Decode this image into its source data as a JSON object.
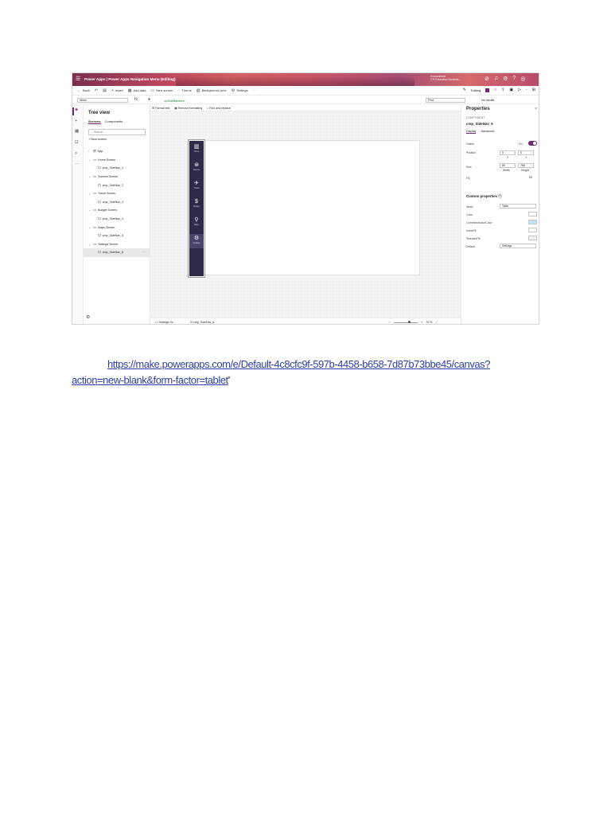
{
  "titlebar": {
    "title": "Power Apps | Power Apps Navigation Menu (Editing)",
    "environment_line1": "Environment",
    "environment_line2": "CTI Education Services..."
  },
  "commandbar": {
    "back": "Back",
    "insert": "Insert",
    "add_data": "Add data",
    "new_screen": "New screen",
    "theme": "Theme",
    "background_color": "Background color",
    "settings": "Settings",
    "more": "···",
    "editing": "Editing"
  },
  "formula": {
    "property": "Items",
    "fx": "fx",
    "value": "colSideBarMenu"
  },
  "find": {
    "placeholder": "Find",
    "no_results": "No results"
  },
  "tree": {
    "title": "Tree view",
    "tabs": [
      "Screens",
      "Components"
    ],
    "search_placeholder": "Search",
    "new_screen": "New screen",
    "items": [
      {
        "label": "App",
        "level": 0,
        "icon": "app-icon"
      },
      {
        "label": "Home Screen",
        "level": 0,
        "icon": "screen-icon"
      },
      {
        "label": "cmp_SideNav_1",
        "level": 1,
        "icon": "component-icon"
      },
      {
        "label": "Science Screen",
        "level": 0,
        "icon": "screen-icon"
      },
      {
        "label": "cmp_SideNav_2",
        "level": 1,
        "icon": "component-icon"
      },
      {
        "label": "Travel Screen",
        "level": 0,
        "icon": "screen-icon"
      },
      {
        "label": "cmp_SideNav_3",
        "level": 1,
        "icon": "component-icon"
      },
      {
        "label": "Budget Screen",
        "level": 0,
        "icon": "screen-icon"
      },
      {
        "label": "cmp_SideNav_4",
        "level": 1,
        "icon": "component-icon"
      },
      {
        "label": "Maps Screen",
        "level": 0,
        "icon": "screen-icon"
      },
      {
        "label": "cmp_SideNav_5",
        "level": 1,
        "icon": "component-icon"
      },
      {
        "label": "Settings Screen",
        "level": 0,
        "icon": "screen-icon"
      },
      {
        "label": "cmp_SideNav_6",
        "level": 1,
        "icon": "component-icon",
        "selected": true
      }
    ]
  },
  "formatbar": {
    "format_text": "Format text",
    "remove_formatting": "Remove formatting",
    "find_replace": "Find and replace"
  },
  "sidenav": {
    "items": [
      {
        "label": "Home",
        "icon": "home-icon",
        "glyph": "▥"
      },
      {
        "label": "Science",
        "icon": "atom-icon",
        "glyph": "⊛"
      },
      {
        "label": "Travel",
        "icon": "plane-icon",
        "glyph": "✈"
      },
      {
        "label": "Budget",
        "icon": "dollar-icon",
        "glyph": "$"
      },
      {
        "label": "Maps",
        "icon": "map-pin-icon",
        "glyph": "⚲"
      },
      {
        "label": "Settings",
        "icon": "gear-icon",
        "glyph": "⚙",
        "selected": true
      }
    ],
    "background": "#2d2b48"
  },
  "canvas_footer": {
    "screen": "Settings Sc...",
    "component": "cmp_SideNav_6",
    "zoom": "70 %"
  },
  "properties": {
    "title": "Properties",
    "kind": "COMPONENT",
    "name": "cmp_SideNav_6",
    "tabs": [
      "Display",
      "Advanced"
    ],
    "visible_label": "Visible",
    "visible_value": "On",
    "position_label": "Position",
    "position_x": "0",
    "position_y": "0",
    "x_label": "X",
    "y_label": "Y",
    "size_label": "Size",
    "size_w": "80",
    "size_h": "768",
    "width_label": "Width",
    "height_label": "Height",
    "fill_label": "Fill",
    "custom_props": "Custom properties",
    "items_label": "Items",
    "items_value": "Table",
    "color_label": "Color",
    "current_indicator_label": "CurrentIndicatorColor",
    "icon_fill_label": "IconsFill",
    "selected_fill_label": "SelectedFill",
    "default_label": "Default",
    "default_value": "Settings",
    "accent": "#742774"
  },
  "link": {
    "line1": "https://make.powerapps.com/e/Default-4c8cfc9f-597b-4458-b658-7d87b73bbe45/canvas?",
    "line2": "action=new-blank&form-factor=tablet",
    "trailing": "'"
  }
}
